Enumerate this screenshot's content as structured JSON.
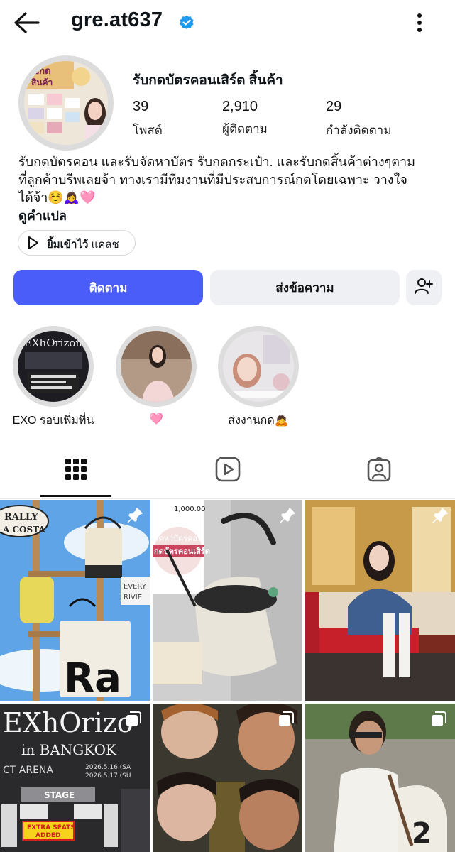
{
  "header": {
    "username": "gre.at637",
    "icons": {
      "back": "arrow-left-icon",
      "verified": "verified-badge-icon",
      "more": "more-vertical-icon"
    }
  },
  "profile": {
    "display_name": "รับกดบัตรคอนเสิร์ต สิ้นค้า",
    "stats": [
      {
        "value": "39",
        "label": "โพสต์"
      },
      {
        "value": "2,910",
        "label": "ผู้ติดตาม"
      },
      {
        "value": "29",
        "label": "กำลังติดตาม"
      }
    ],
    "bio_line1": "รับกดบัตรคอน และรับจัดหาบัตร รับกดกระเป๋า.  และรับกดสิ้นค้าต่างๆตาม",
    "bio_line2": "ที่ลูกค้าบรีพเลยจ้า ทางเรามีทีมงานที่มีประสบการณ์กดโดยเฉพาะ วางใจ",
    "bio_line3": "ได้จ้า☺️🙇‍♀️🩷",
    "translate": "ดูคำแปล",
    "music_pill": {
      "song": "ยิ้มเข้าไว้",
      "artist": "แคลช"
    }
  },
  "actions": {
    "follow": "ติดตาม",
    "message": "ส่งข้อความ",
    "add_user_icon": "add-person-icon"
  },
  "highlights": [
    {
      "label": "EXO รอบเพิ่มที่น",
      "cover_text": "EXhOrizon"
    },
    {
      "label": "🩷",
      "cover_text": ""
    },
    {
      "label": "ส่งงานกด🙇",
      "cover_text": ""
    }
  ],
  "tabs": [
    {
      "name": "posts",
      "icon": "grid-icon",
      "active": true
    },
    {
      "name": "reels",
      "icon": "reels-icon",
      "active": false
    },
    {
      "name": "tagged",
      "icon": "tagged-person-icon",
      "active": false
    }
  ],
  "grid": [
    {
      "badge": "pin-icon",
      "texts": [
        "RALLY",
        "A COSTA",
        "EVERY",
        "RIVIE",
        "Ra"
      ]
    },
    {
      "badge": "pin-icon",
      "texts": [
        "1,000.00",
        "กดบัตรคอนเสิร์ต"
      ]
    },
    {
      "badge": "pin-icon",
      "texts": []
    },
    {
      "badge": "carousel-icon",
      "texts": [
        "EXhOrizo",
        "in BANGKOK",
        "CT ARENA",
        "2026.5.16 (SA",
        "2026.5.17 (SU",
        "STAGE",
        "EXTRA SEATS ADDED"
      ]
    },
    {
      "badge": "carousel-icon",
      "texts": []
    },
    {
      "badge": "carousel-icon",
      "texts": []
    }
  ]
}
